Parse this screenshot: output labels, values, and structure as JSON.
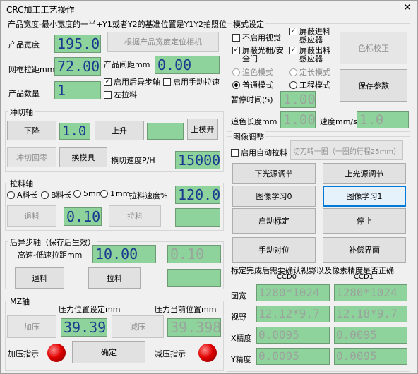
{
  "window": {
    "title": "CRC加工工艺操作",
    "close": "✕"
  },
  "product": {
    "header": "产品宽度-最小宽度的一半+Y1或者Y2的基准位置是Y1Y2拍照位",
    "width_label": "产品宽度",
    "width_value": "195.00",
    "locate_button": "根据产品宽度定位相机",
    "mesh_label": "网框拉距mm",
    "mesh_value": "72.00",
    "gap_label": "产品间距mm",
    "gap_value": "0.00",
    "rear_step": "启用后异步轴",
    "manual_pull": "启用手动拉速",
    "count_label": "产品数量",
    "count_value": "1",
    "left_pull": "左拉料"
  },
  "mode": {
    "title": "模式设定",
    "no_vision": "不启用视觉",
    "mask_in": "屏蔽进料感应器",
    "mask_grating": "屏蔽光栅/安全门",
    "mask_out": "屏蔽出料感应器",
    "color_button": "色标校正",
    "radio_track": "追色模式",
    "radio_fixed": "定长模式",
    "radio_normal": "普通模式",
    "radio_process": "工程模式",
    "save_button": "保存参数",
    "pause_label": "暂停时间(S)",
    "pause_value": "1.00",
    "track_len_label": "追色长度mm",
    "track_len_value": "1.00",
    "speed_label": "速度mm/s",
    "speed_value": "1.0"
  },
  "cut": {
    "title": "冲切轴",
    "down": "下降",
    "value": "1.0",
    "up": "上升",
    "open": "上模开",
    "zero": "冲切回零",
    "change": "换模具",
    "speed_label": "横切速度P/H",
    "speed_value": "15000"
  },
  "pull": {
    "title": "拉料轴",
    "a": "A料长",
    "b": "B料长",
    "mm5": "5mm",
    "mm1": "1mm",
    "speed_label": "拉料速度%",
    "speed_value": "120.0",
    "back": "退料",
    "value": "0.10",
    "forward": "拉料"
  },
  "rear": {
    "title": "后异步轴（保存后生效）",
    "dist_label": "高速-低速拉距mm",
    "dist_value": "10.00",
    "dist_value2": "0.10",
    "back": "退料",
    "forward": "拉料"
  },
  "mz": {
    "title": "MZ轴",
    "set_label": "压力位置设定mm",
    "cur_label": "压力当前位置mm",
    "press": "加压",
    "set_value": "39.398",
    "release": "减压",
    "cur_value": "39.398",
    "press_ind": "加压指示",
    "confirm": "确定",
    "release_ind": "减压指示"
  },
  "image": {
    "title": "图像调整",
    "auto_pull": "启用自动拉料",
    "rotate": "切刀转一圈（一圈的行程25mm）",
    "lower_light": "下光源调节",
    "upper_light": "上光源调节",
    "learn0": "图像学习0",
    "learn1": "图像学习1",
    "start_cal": "启动标定",
    "stop": "停止",
    "manual_align": "手动对位",
    "compensate": "补偿界面",
    "note": "标定完成后需要确认视野以及像素精度是否正确",
    "ccd0": "CCD0",
    "ccd1": "CCD1",
    "res_label": "图宽",
    "res0": "1280*1024",
    "res1": "1280*1024",
    "fov_label": "视野",
    "fov0": "12.12*9.7",
    "fov1": "12.18*9.7",
    "x_label": "X精度",
    "x0": "0.0095",
    "x1": "0.0095",
    "y_label": "Y精度",
    "y0": "0.0095",
    "y1": "0.0095"
  }
}
